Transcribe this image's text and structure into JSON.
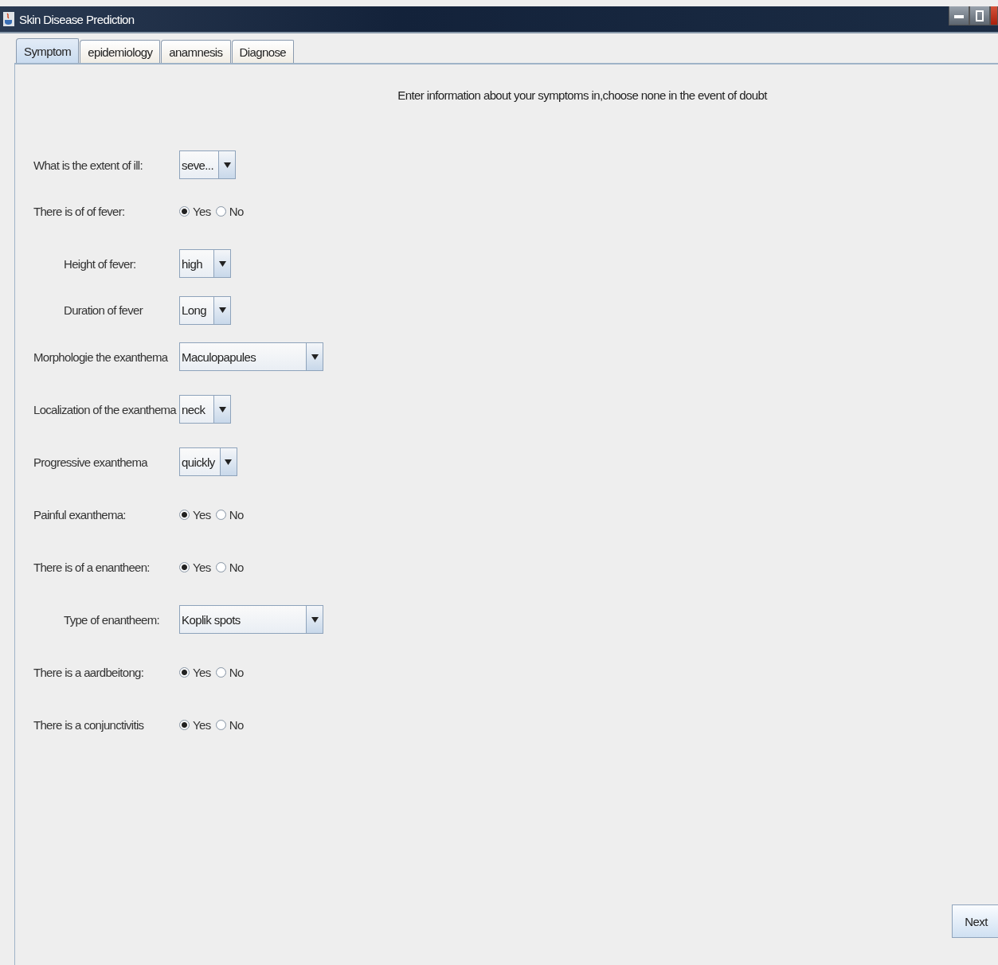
{
  "window": {
    "title": "Skin Disease Prediction"
  },
  "tabs": [
    {
      "label": "Symptom",
      "selected": true
    },
    {
      "label": "epidemiology",
      "selected": false
    },
    {
      "label": "anamnesis",
      "selected": false
    },
    {
      "label": "Diagnose",
      "selected": false
    }
  ],
  "instruction": "Enter information about your symptoms in,choose none in the event of doubt",
  "fields": [
    {
      "kind": "combo",
      "label": "What is the extent of ill:",
      "indented": false,
      "value": "seve..."
    },
    {
      "kind": "radio",
      "label": "There is of of fever:",
      "indented": false,
      "options": [
        {
          "label": "Yes",
          "selected": true
        },
        {
          "label": "No",
          "selected": false
        }
      ]
    },
    {
      "kind": "combo",
      "label": "Height of fever:",
      "indented": true,
      "value": "high"
    },
    {
      "kind": "combo",
      "label": "Duration of fever",
      "indented": true,
      "value": "Long"
    },
    {
      "kind": "combo",
      "label": "Morphologie the exanthema",
      "indented": false,
      "value": "Maculopapules"
    },
    {
      "kind": "combo",
      "label": "Localization of the exanthema",
      "indented": false,
      "value": "neck"
    },
    {
      "kind": "combo",
      "label": "Progressive exanthema",
      "indented": false,
      "value": "quickly"
    },
    {
      "kind": "radio",
      "label": "Painful exanthema:",
      "indented": false,
      "options": [
        {
          "label": "Yes",
          "selected": true
        },
        {
          "label": "No",
          "selected": false
        }
      ]
    },
    {
      "kind": "radio",
      "label": "There is of a enantheen:",
      "indented": false,
      "options": [
        {
          "label": "Yes",
          "selected": true
        },
        {
          "label": "No",
          "selected": false
        }
      ]
    },
    {
      "kind": "combo",
      "label": "Type of enantheem:",
      "indented": true,
      "value": "Koplik spots"
    },
    {
      "kind": "radio",
      "label": "There is a aardbeitong:",
      "indented": false,
      "options": [
        {
          "label": "Yes",
          "selected": true
        },
        {
          "label": "No",
          "selected": false
        }
      ]
    },
    {
      "kind": "radio",
      "label": "There is a conjunctivitis",
      "indented": false,
      "options": [
        {
          "label": "Yes",
          "selected": true
        },
        {
          "label": "No",
          "selected": false
        }
      ]
    }
  ],
  "next_button": "Next"
}
